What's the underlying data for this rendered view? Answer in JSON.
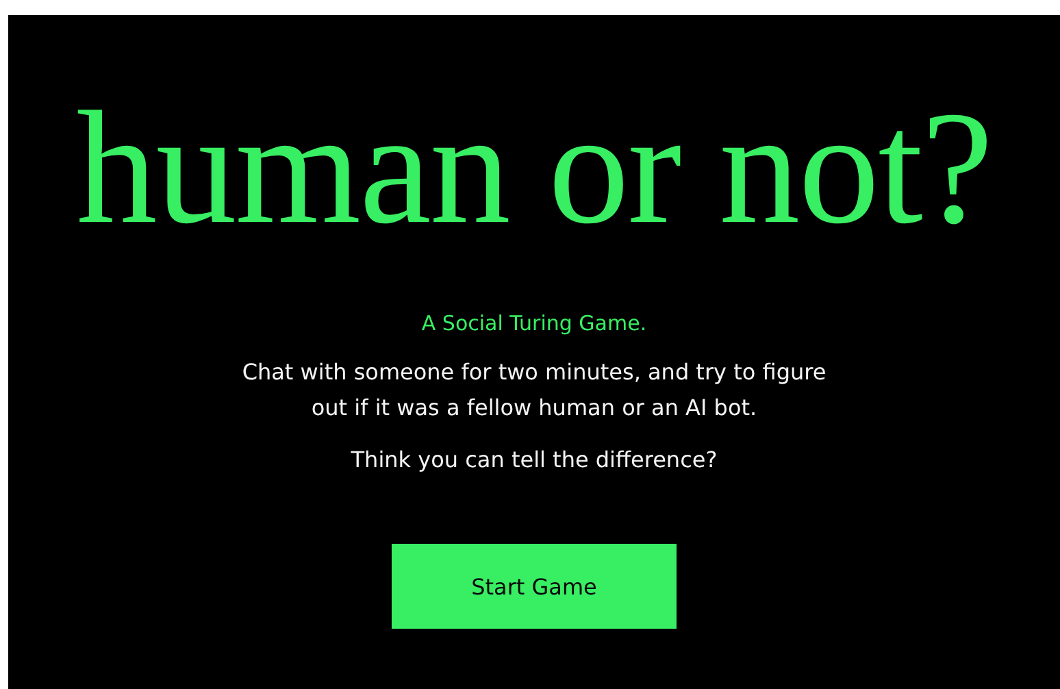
{
  "title": "human or not?",
  "tagline": "A Social Turing Game.",
  "description": "Chat with someone for two minutes, and try to figure out if it was a fellow human or an AI bot.",
  "question": "Think you can tell the difference?",
  "button": {
    "label": "Start Game"
  }
}
